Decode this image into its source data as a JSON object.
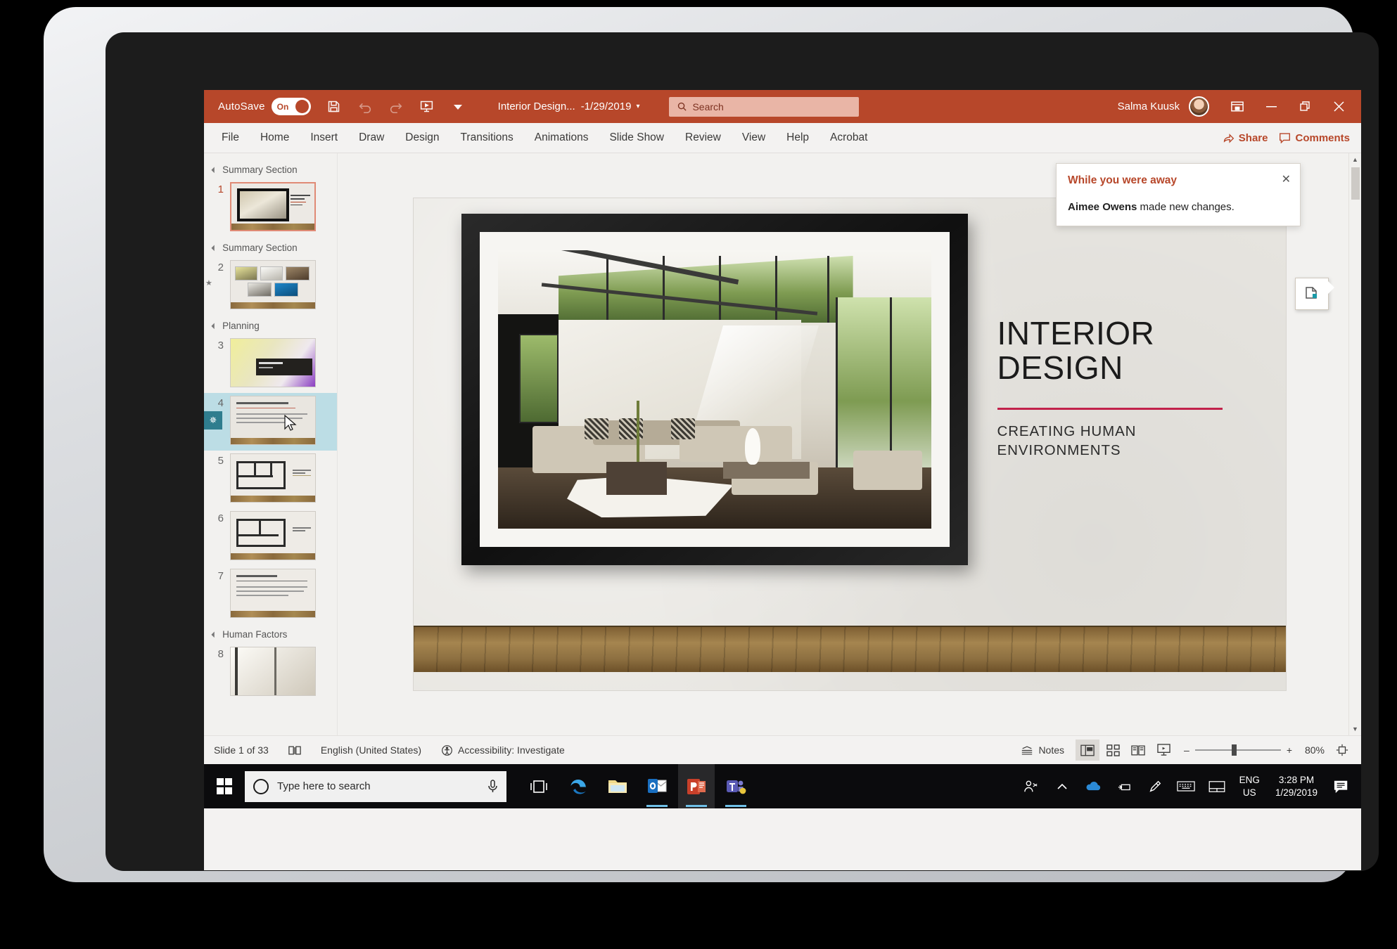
{
  "app": {
    "titlebar": {
      "autosave_label": "AutoSave",
      "autosave_state": "On",
      "document_title": "Interior Design...",
      "document_date": "-1/29/2019",
      "search_placeholder": "Search",
      "user_name": "Salma Kuusk",
      "icons": [
        "save-icon",
        "undo-icon",
        "redo-icon",
        "start-presentation-icon",
        "customize-quick-access-icon"
      ],
      "window_controls": [
        "ribbon-display-options",
        "minimize",
        "restore",
        "close"
      ]
    },
    "ribbon": {
      "tabs": [
        "File",
        "Home",
        "Insert",
        "Draw",
        "Design",
        "Transitions",
        "Animations",
        "Slide Show",
        "Review",
        "View",
        "Help",
        "Acrobat"
      ],
      "share_label": "Share",
      "comments_label": "Comments"
    },
    "notification": {
      "title": "While you were away",
      "author": "Aimee Owens",
      "message": " made new changes."
    },
    "thumbnails": {
      "sections": [
        {
          "name": "Summary Section",
          "slides": [
            {
              "number": "1",
              "type": "title-framed-photo",
              "selected_outline": true
            }
          ]
        },
        {
          "name": "Summary Section",
          "slides": [
            {
              "number": "2",
              "type": "photo-grid",
              "has_star": true
            }
          ]
        },
        {
          "name": "Planning",
          "slides": [
            {
              "number": "3",
              "type": "planning-banner"
            },
            {
              "number": "4",
              "type": "bulleted-text",
              "selected": true,
              "has_animation": true
            },
            {
              "number": "5",
              "type": "floorplan"
            },
            {
              "number": "6",
              "type": "floorplan"
            },
            {
              "number": "7",
              "type": "bulleted-text"
            }
          ]
        },
        {
          "name": "Human Factors",
          "slides": [
            {
              "number": "8",
              "type": "photo"
            }
          ]
        }
      ]
    },
    "slide": {
      "title_line1": "INTERIOR",
      "title_line2": "DESIGN",
      "subtitle_line1": "CREATING HUMAN",
      "subtitle_line2": "ENVIRONMENTS",
      "accent_rule_color": "#c2224b",
      "photo_alt": "Modern sunlit living room with sectional sofa, tall windows and greenery"
    },
    "statusbar": {
      "slide_count": "Slide 1 of 33",
      "language": "English (United States)",
      "accessibility": "Accessibility: Investigate",
      "notes_label": "Notes",
      "views": [
        "normal-view",
        "slide-sorter-view",
        "reading-view",
        "slide-show-view"
      ],
      "active_view": "normal-view",
      "zoom_minus": "–",
      "zoom_plus": "+",
      "zoom_level": "80%",
      "fit_slide_label": "fit-slide-to-window"
    },
    "taskbar": {
      "search_placeholder": "Type here to search",
      "apps": [
        {
          "name": "task-view",
          "label": "Task View"
        },
        {
          "name": "edge",
          "label": "Microsoft Edge"
        },
        {
          "name": "file-explorer",
          "label": "File Explorer"
        },
        {
          "name": "outlook",
          "label": "Outlook"
        },
        {
          "name": "powerpoint",
          "label": "PowerPoint"
        },
        {
          "name": "teams",
          "label": "Microsoft Teams"
        }
      ],
      "tray_icons": [
        "people-icon",
        "show-hidden-icons-icon",
        "onedrive-icon",
        "network-icon",
        "pen-icon",
        "touch-keyboard-icon",
        "touchpad-icon"
      ],
      "language": "ENG",
      "region": "US",
      "time": "3:28 PM",
      "date": "1/29/2019",
      "action_center": "action-center-icon"
    },
    "colors": {
      "brand_red": "#b7472a",
      "accent_pink": "#c2224b",
      "chrome_gray": "#f3f2f1",
      "selection_blue": "#bcdde5"
    }
  }
}
